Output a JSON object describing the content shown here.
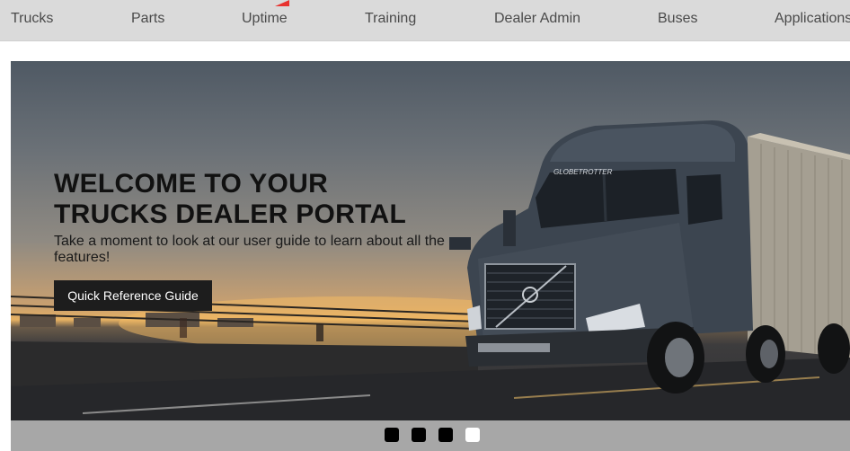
{
  "nav": {
    "items": [
      {
        "label": "Trucks"
      },
      {
        "label": "Parts"
      },
      {
        "label": "Uptime"
      },
      {
        "label": "Training"
      },
      {
        "label": "Dealer Admin"
      },
      {
        "label": "Buses"
      },
      {
        "label": "Applications"
      }
    ]
  },
  "hero": {
    "title_line1": "WELCOME TO YOUR",
    "title_line2": "TRUCKS DEALER PORTAL",
    "subtitle": "Take a moment to look at our user guide to learn about all the features!",
    "button_label": "Quick Reference Guide",
    "truck_badge": "GLOBETROTTER"
  },
  "carousel": {
    "slide_count": 4,
    "active_index": 3
  },
  "colors": {
    "nav_bg": "#dadada",
    "button_bg": "#1d1d1d",
    "dots_bar_bg": "#a7a7a7",
    "marker": "#e8332f"
  }
}
